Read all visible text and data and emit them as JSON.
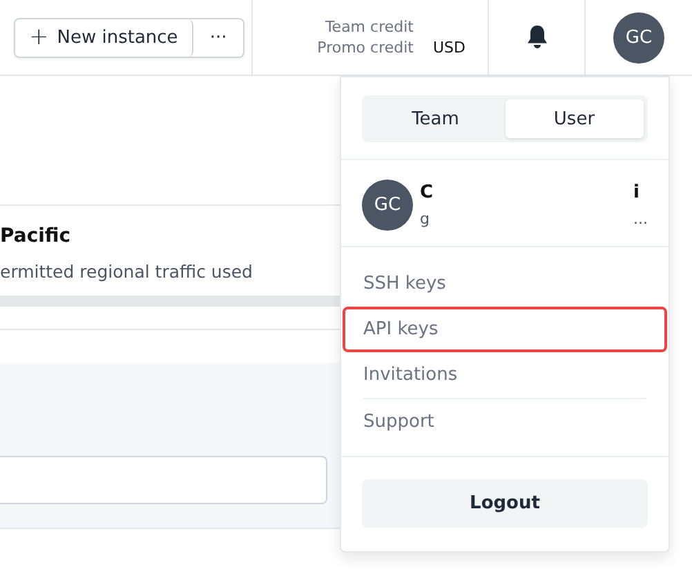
{
  "header": {
    "new_instance_button": {
      "icon": "+",
      "label": "New instance"
    },
    "more_button": "···",
    "credits": {
      "labels": [
        "Team credit",
        "Promo credit"
      ],
      "currency": "USD"
    },
    "avatar": "GC"
  },
  "region_card": {
    "title": "Pacific",
    "subtitle": "ermitted regional traffic used"
  },
  "account_menu": {
    "tabs": [
      {
        "label": "Team",
        "selected": false
      },
      {
        "label": "User",
        "selected": true
      }
    ],
    "profile": {
      "avatar": "GC",
      "name_start": "C",
      "name_end": "i",
      "email_start": "g",
      "email_end": "..."
    },
    "items": [
      {
        "label": "SSH keys",
        "highlighted": false,
        "divider_after": false
      },
      {
        "label": "API keys",
        "highlighted": true,
        "divider_after": false
      },
      {
        "label": "Invitations",
        "highlighted": false,
        "divider_after": true
      },
      {
        "label": "Support",
        "highlighted": false,
        "divider_after": false
      }
    ],
    "logout": "Logout"
  }
}
